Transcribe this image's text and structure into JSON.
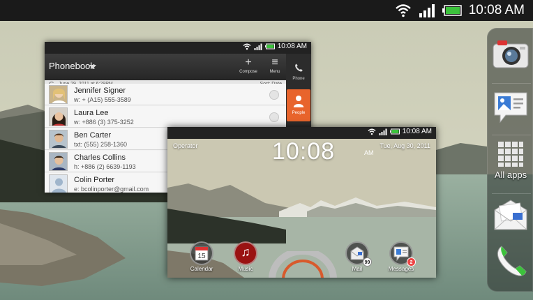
{
  "status_bar": {
    "time": "10:08 AM",
    "icons": [
      "wifi-icon",
      "signal-icon",
      "battery-icon"
    ]
  },
  "dock": {
    "items": [
      {
        "name": "camera",
        "icon": "camera-icon",
        "label": ""
      },
      {
        "name": "gallery",
        "icon": "gallery-icon",
        "label": ""
      },
      {
        "name": "all-apps",
        "icon": "grid-icon",
        "label": "All apps"
      },
      {
        "name": "mail",
        "icon": "mail-icon",
        "label": ""
      },
      {
        "name": "phone",
        "icon": "phone-icon",
        "label": ""
      }
    ]
  },
  "phonebook": {
    "status_time": "10:08 AM",
    "title": "Phonebook",
    "actions": [
      {
        "glyph": "+",
        "label": "Compose"
      },
      {
        "glyph": "≡",
        "label": "Menu"
      }
    ],
    "side_tabs": [
      {
        "label": "Phone",
        "icon": "phone-icon",
        "active": false
      },
      {
        "label": "People",
        "icon": "person-icon",
        "active": true
      }
    ],
    "sync_date": "June 29, 2011 at 6:29PM",
    "sort_label": "Sort: Date",
    "contacts": [
      {
        "name": "Jennifer Signer",
        "detail": "w: + (A15) 555-3589",
        "avatar": "avatar-woman-blonde"
      },
      {
        "name": "Laura Lee",
        "detail": "w: +886 (3) 375-3252",
        "avatar": "avatar-woman-dark"
      },
      {
        "name": "Ben Carter",
        "detail": "txt: (555) 258-1360",
        "avatar": "avatar-man"
      },
      {
        "name": "Charles Collins",
        "detail": "h: +886 (2) 6639-1193",
        "avatar": "avatar-man-2"
      },
      {
        "name": "Colin Porter",
        "detail": "e: bcolinporter@gmail.com",
        "avatar": "avatar-default"
      }
    ]
  },
  "home_preview": {
    "status_time": "10:08 AM",
    "operator": "Operator",
    "clock": "10:08",
    "ampm": "AM",
    "date": "Tue, Aug 30, 2011",
    "apps": [
      {
        "label": "Calendar",
        "icon": "calendar-icon",
        "glyph": "15",
        "badge": ""
      },
      {
        "label": "Music",
        "icon": "music-icon",
        "glyph": "♫",
        "badge": ""
      },
      {
        "label": "Mail",
        "icon": "mail-icon",
        "glyph": "",
        "badge": "99"
      },
      {
        "label": "Messages",
        "icon": "messages-icon",
        "glyph": "",
        "badge": "2"
      }
    ]
  },
  "colors": {
    "accent_orange": "#e8642c",
    "battery_green": "#3cc23c",
    "status_bar": "#1a1a1a"
  }
}
